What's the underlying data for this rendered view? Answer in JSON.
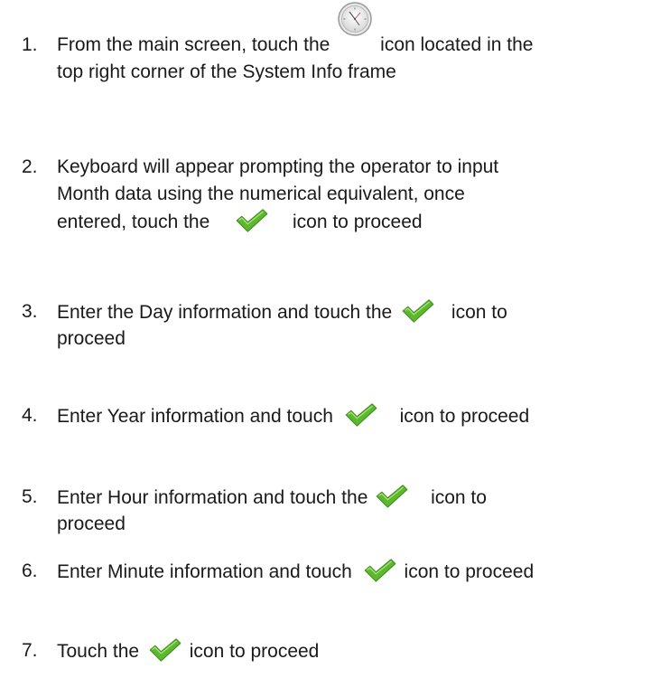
{
  "steps": [
    {
      "number": "1.",
      "before": "From the main screen, touch the",
      "icon": "clock-icon",
      "after": "icon located in the",
      "line2": "top right corner of the System Info frame"
    },
    {
      "number": "2.",
      "line1": "Keyboard will appear prompting the operator to input",
      "line2": "Month data using the numerical equivalent, once",
      "before": "entered, touch the",
      "icon": "checkmark-icon",
      "after": "icon to proceed"
    },
    {
      "number": "3.",
      "before": "Enter the Day information and touch the",
      "icon": "checkmark-icon",
      "after": "icon to",
      "line2": "proceed"
    },
    {
      "number": "4.",
      "before": "Enter Year information and touch",
      "icon": "checkmark-icon",
      "after": "icon to proceed"
    },
    {
      "number": "5.",
      "before": "Enter Hour information and touch the",
      "icon": "checkmark-icon",
      "after": "icon to",
      "line2": "proceed"
    },
    {
      "number": "6.",
      "before": "Enter Minute information and touch",
      "icon": "checkmark-icon",
      "after": "icon to proceed"
    },
    {
      "number": "7.",
      "before": "Touch the",
      "icon": "checkmark-icon",
      "after": "icon to proceed"
    }
  ],
  "colors": {
    "text": "#1a1a1a",
    "check_green": "#5cb82e",
    "check_dark": "#3f8f1c"
  }
}
